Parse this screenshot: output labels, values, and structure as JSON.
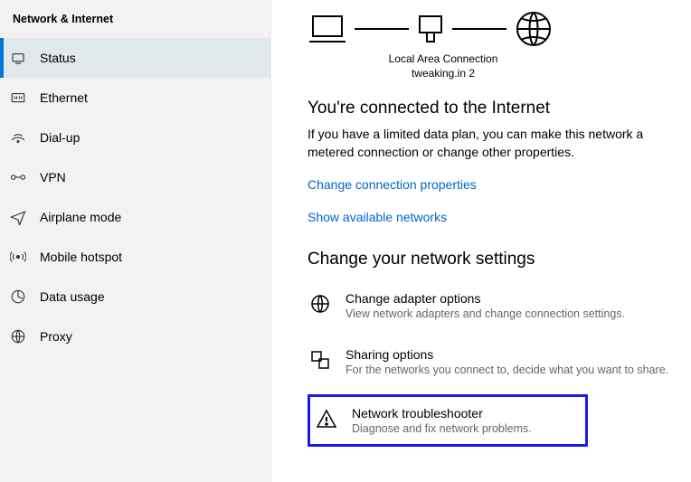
{
  "sidebar": {
    "title": "Network & Internet",
    "items": [
      {
        "label": "Status"
      },
      {
        "label": "Ethernet"
      },
      {
        "label": "Dial-up"
      },
      {
        "label": "VPN"
      },
      {
        "label": "Airplane mode"
      },
      {
        "label": "Mobile hotspot"
      },
      {
        "label": "Data usage"
      },
      {
        "label": "Proxy"
      }
    ]
  },
  "main": {
    "diagram": {
      "caption_line1": "Local Area Connection",
      "caption_line2": "tweaking.in 2"
    },
    "connected_heading": "You're connected to the Internet",
    "connected_body": "If you have a limited data plan, you can make this network a metered connection or change other properties.",
    "link_change_props": "Change connection properties",
    "link_show_networks": "Show available networks",
    "section_heading": "Change your network settings",
    "settings": [
      {
        "title": "Change adapter options",
        "desc": "View network adapters and change connection settings."
      },
      {
        "title": "Sharing options",
        "desc": "For the networks you connect to, decide what you want to share."
      },
      {
        "title": "Network troubleshooter",
        "desc": "Diagnose and fix network problems."
      }
    ]
  }
}
